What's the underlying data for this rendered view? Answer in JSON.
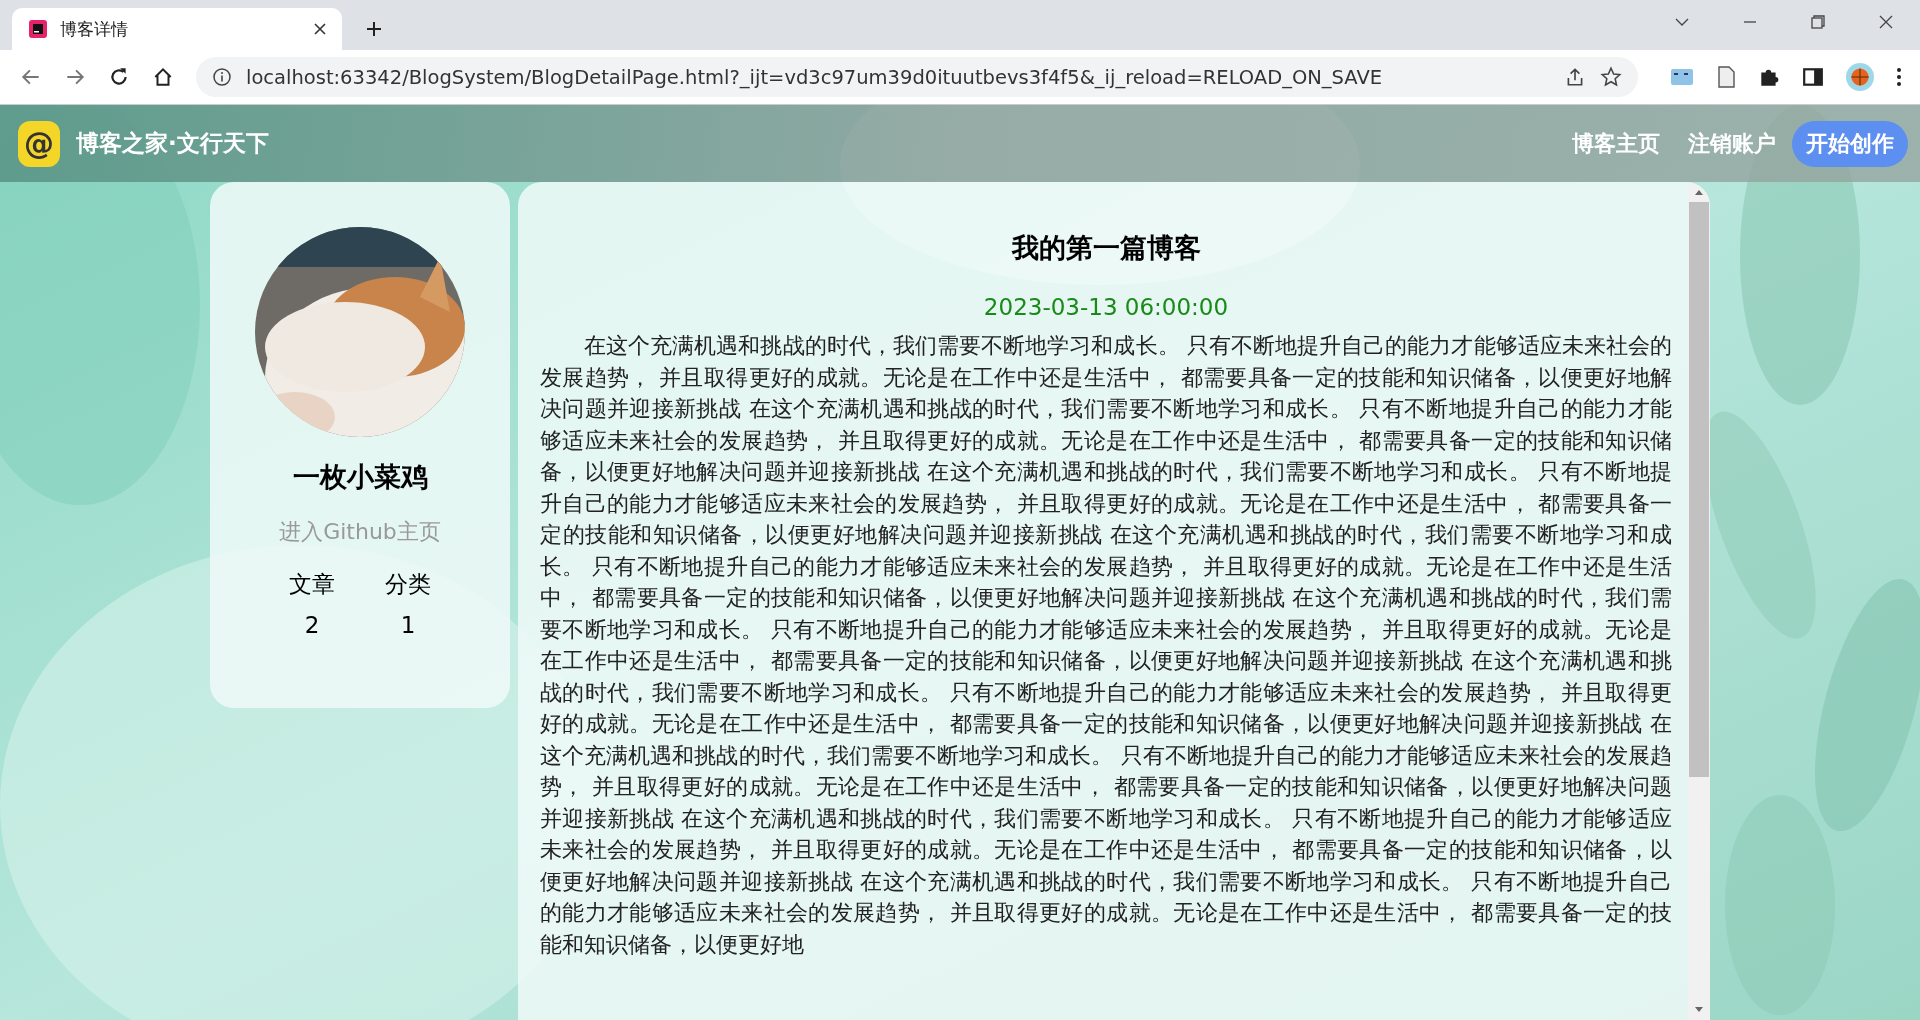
{
  "browser": {
    "tab": {
      "title": "博客详情"
    },
    "url": "localhost:63342/BlogSystem/BlogDetailPage.html?_ijt=vd3c97um39d0ituutbevs3f4f5&_ij_reload=RELOAD_ON_SAVE"
  },
  "header": {
    "logo_glyph": "@",
    "site_name": "博客之家·文行天下",
    "nav": [
      {
        "label": "博客主页",
        "kind": "link"
      },
      {
        "label": "注销账户",
        "kind": "link"
      },
      {
        "label": "开始创作",
        "kind": "button"
      }
    ]
  },
  "profile": {
    "name": "一枚小菜鸡",
    "github_link": "进入Github主页",
    "stats": [
      {
        "label": "文章",
        "value": "2"
      },
      {
        "label": "分类",
        "value": "1"
      }
    ]
  },
  "article": {
    "title": "我的第一篇博客",
    "date": "2023-03-13 06:00:00",
    "body": "在这个充满机遇和挑战的时代，我们需要不断地学习和成长。 只有不断地提升自己的能力才能够适应未来社会的发展趋势， 并且取得更好的成就。无论是在工作中还是生活中， 都需要具备一定的技能和知识储备，以便更好地解决问题并迎接新挑战 在这个充满机遇和挑战的时代，我们需要不断地学习和成长。 只有不断地提升自己的能力才能够适应未来社会的发展趋势， 并且取得更好的成就。无论是在工作中还是生活中， 都需要具备一定的技能和知识储备，以便更好地解决问题并迎接新挑战 在这个充满机遇和挑战的时代，我们需要不断地学习和成长。 只有不断地提升自己的能力才能够适应未来社会的发展趋势， 并且取得更好的成就。无论是在工作中还是生活中， 都需要具备一定的技能和知识储备，以便更好地解决问题并迎接新挑战 在这个充满机遇和挑战的时代，我们需要不断地学习和成长。 只有不断地提升自己的能力才能够适应未来社会的发展趋势， 并且取得更好的成就。无论是在工作中还是生活中， 都需要具备一定的技能和知识储备，以便更好地解决问题并迎接新挑战 在这个充满机遇和挑战的时代，我们需要不断地学习和成长。 只有不断地提升自己的能力才能够适应未来社会的发展趋势， 并且取得更好的成就。无论是在工作中还是生活中， 都需要具备一定的技能和知识储备，以便更好地解决问题并迎接新挑战 在这个充满机遇和挑战的时代，我们需要不断地学习和成长。 只有不断地提升自己的能力才能够适应未来社会的发展趋势， 并且取得更好的成就。无论是在工作中还是生活中， 都需要具备一定的技能和知识储备，以便更好地解决问题并迎接新挑战 在这个充满机遇和挑战的时代，我们需要不断地学习和成长。 只有不断地提升自己的能力才能够适应未来社会的发展趋势， 并且取得更好的成就。无论是在工作中还是生活中， 都需要具备一定的技能和知识储备，以便更好地解决问题并迎接新挑战 在这个充满机遇和挑战的时代，我们需要不断地学习和成长。 只有不断地提升自己的能力才能够适应未来社会的发展趋势， 并且取得更好的成就。无论是在工作中还是生活中， 都需要具备一定的技能和知识储备，以便更好地解决问题并迎接新挑战 在这个充满机遇和挑战的时代，我们需要不断地学习和成长。 只有不断地提升自己的能力才能够适应未来社会的发展趋势， 并且取得更好的成就。无论是在工作中还是生活中， 都需要具备一定的技能和知识储备，以便更好地"
  }
}
